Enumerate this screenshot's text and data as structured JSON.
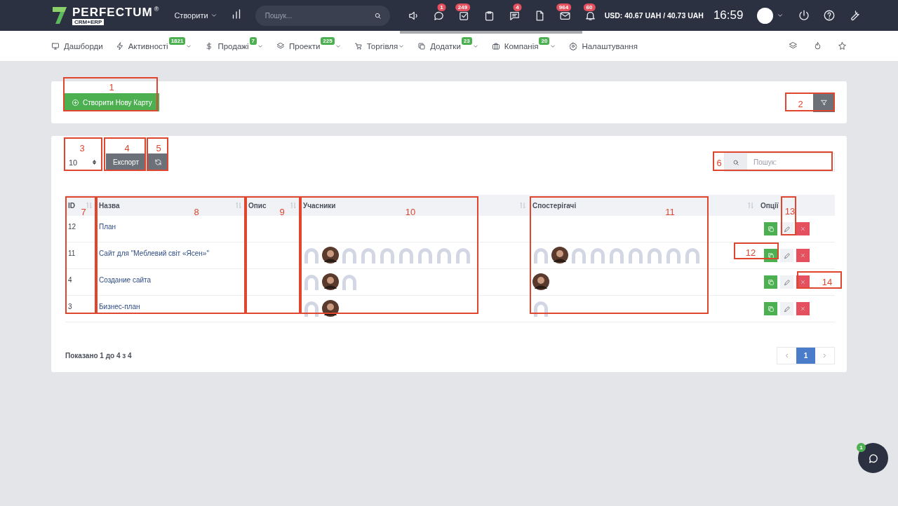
{
  "topbar": {
    "logo": "PERFECTUM",
    "logo_mark": "®",
    "logo_sub": "CRM+ERP",
    "create_menu": "Створити",
    "search": {
      "placeholder": "Пошук..."
    },
    "notification_badges": [
      "1",
      "249",
      "4",
      "964",
      "60"
    ],
    "currency": "USD: 40.67 UAH / 40.73 UAH",
    "time": "16:59"
  },
  "nav": [
    {
      "label": "Дашборди",
      "has_menu": false
    },
    {
      "label": "Активності",
      "badge": "1821",
      "has_menu": true
    },
    {
      "label": "Продажі",
      "badge": "7",
      "has_menu": true
    },
    {
      "label": "Проекти",
      "badge": "225",
      "has_menu": true
    },
    {
      "label": "Торгівля",
      "has_menu": true
    },
    {
      "label": "Додатки",
      "badge": "23",
      "has_menu": true
    },
    {
      "label": "Компанія",
      "badge": "20",
      "has_menu": true
    },
    {
      "label": "Налаштування",
      "has_menu": false
    }
  ],
  "create_button": "Створити Нову Карту",
  "page_length": "10",
  "export_button": "Експорт",
  "table_search": {
    "placeholder": "Пошук:"
  },
  "table": {
    "columns": [
      {
        "label": "ID",
        "sortable": true
      },
      {
        "label": "Назва",
        "sortable": true
      },
      {
        "label": "Опис",
        "sortable": true
      },
      {
        "label": "Учасники",
        "sortable": true
      },
      {
        "label": "Спостерігачі",
        "sortable": true
      },
      {
        "label": "Опції",
        "sortable": false
      }
    ],
    "rows": [
      {
        "id": "12",
        "name": "План",
        "members": [],
        "watchers": []
      },
      {
        "id": "11",
        "name": "Сайт для \"Меблевий світ «Ясен»\"",
        "members": [
          {
            "kind": "placeholder"
          },
          {
            "kind": "photo"
          },
          {
            "kind": "placeholder"
          },
          {
            "kind": "placeholder"
          },
          {
            "kind": "placeholder"
          },
          {
            "kind": "placeholder"
          },
          {
            "kind": "placeholder"
          },
          {
            "kind": "placeholder"
          },
          {
            "kind": "placeholder"
          }
        ],
        "watchers": [
          {
            "kind": "placeholder"
          },
          {
            "kind": "photo"
          },
          {
            "kind": "placeholder"
          },
          {
            "kind": "placeholder"
          },
          {
            "kind": "placeholder"
          },
          {
            "kind": "placeholder"
          },
          {
            "kind": "placeholder"
          },
          {
            "kind": "placeholder"
          },
          {
            "kind": "placeholder"
          }
        ]
      },
      {
        "id": "4",
        "name": "Создание сайта",
        "members": [
          {
            "kind": "placeholder"
          },
          {
            "kind": "photo"
          },
          {
            "kind": "placeholder"
          }
        ],
        "watchers": [
          {
            "kind": "photo"
          }
        ]
      },
      {
        "id": "3",
        "name": "Бизнес-план",
        "members": [
          {
            "kind": "placeholder"
          },
          {
            "kind": "photo"
          }
        ],
        "watchers": [
          {
            "kind": "placeholder"
          }
        ]
      }
    ]
  },
  "footer_info": "Показано 1 до 4 з 4",
  "pagination": [
    {
      "label": "1",
      "selected": true
    }
  ],
  "chat_badge": "1",
  "callouts": [
    "1",
    "2",
    "3",
    "4",
    "5",
    "6",
    "7",
    "8",
    "9",
    "10",
    "11",
    "12",
    "13",
    "14"
  ]
}
